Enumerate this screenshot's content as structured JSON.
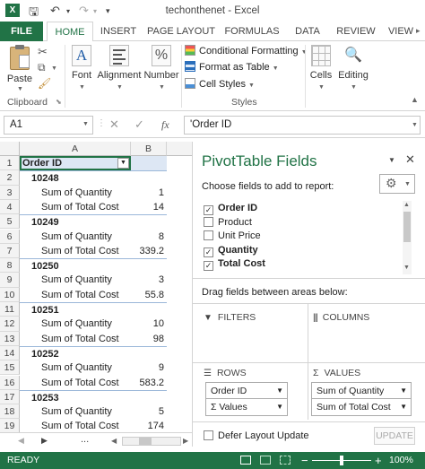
{
  "window": {
    "title": "techonthenet - Excel"
  },
  "ribbon": {
    "tabs": [
      "FILE",
      "HOME",
      "INSERT",
      "PAGE LAYOUT",
      "FORMULAS",
      "DATA",
      "REVIEW",
      "VIEW"
    ],
    "active_tab": "HOME",
    "paste_label": "Paste",
    "clipboard_label": "Clipboard",
    "font_label": "Font",
    "alignment_label": "Alignment",
    "number_label": "Number",
    "conditional_formatting": "Conditional Formatting",
    "format_as_table": "Format as Table",
    "cell_styles": "Cell Styles",
    "styles_label": "Styles",
    "cells_label": "Cells",
    "editing_label": "Editing"
  },
  "formula_bar": {
    "name_box": "A1",
    "fx": "fx",
    "formula": "'Order ID"
  },
  "grid": {
    "col_headers": [
      "A",
      "B"
    ],
    "rows": [
      {
        "n": "1",
        "a": "Order ID",
        "b": "",
        "type": "header"
      },
      {
        "n": "2",
        "a": "10248",
        "b": "",
        "type": "order"
      },
      {
        "n": "3",
        "a": "Sum of Quantity",
        "b": "1",
        "type": "val"
      },
      {
        "n": "4",
        "a": "Sum of Total Cost",
        "b": "14",
        "type": "val"
      },
      {
        "n": "5",
        "a": "10249",
        "b": "",
        "type": "order"
      },
      {
        "n": "6",
        "a": "Sum of Quantity",
        "b": "8",
        "type": "val"
      },
      {
        "n": "7",
        "a": "Sum of Total Cost",
        "b": "339.2",
        "type": "val"
      },
      {
        "n": "8",
        "a": "10250",
        "b": "",
        "type": "order"
      },
      {
        "n": "9",
        "a": "Sum of Quantity",
        "b": "3",
        "type": "val"
      },
      {
        "n": "10",
        "a": "Sum of Total Cost",
        "b": "55.8",
        "type": "val"
      },
      {
        "n": "11",
        "a": "10251",
        "b": "",
        "type": "order"
      },
      {
        "n": "12",
        "a": "Sum of Quantity",
        "b": "10",
        "type": "val"
      },
      {
        "n": "13",
        "a": "Sum of Total Cost",
        "b": "98",
        "type": "val"
      },
      {
        "n": "14",
        "a": "10252",
        "b": "",
        "type": "order"
      },
      {
        "n": "15",
        "a": "Sum of Quantity",
        "b": "9",
        "type": "val"
      },
      {
        "n": "16",
        "a": "Sum of Total Cost",
        "b": "583.2",
        "type": "val"
      },
      {
        "n": "17",
        "a": "10253",
        "b": "",
        "type": "order"
      },
      {
        "n": "18",
        "a": "Sum of Quantity",
        "b": "5",
        "type": "val"
      },
      {
        "n": "19",
        "a": "Sum of Total Cost",
        "b": "174",
        "type": "val"
      }
    ]
  },
  "pivot": {
    "title": "PivotTable Fields",
    "choose_label": "Choose fields to add to report:",
    "fields": [
      {
        "label": "Order ID",
        "checked": true,
        "bold": true
      },
      {
        "label": "Product",
        "checked": false,
        "bold": false
      },
      {
        "label": "Unit Price",
        "checked": false,
        "bold": false
      },
      {
        "label": "Quantity",
        "checked": true,
        "bold": true
      },
      {
        "label": "Total Cost",
        "checked": true,
        "bold": true
      }
    ],
    "drag_label": "Drag fields between areas below:",
    "filters_label": "FILTERS",
    "columns_label": "COLUMNS",
    "rows_label": "ROWS",
    "values_label": "VALUES",
    "rows_items": [
      "Order ID",
      "Σ Values"
    ],
    "values_items": [
      "Sum of Quantity",
      "Sum of Total Cost"
    ],
    "defer_label": "Defer Layout Update",
    "update_label": "UPDATE"
  },
  "status": {
    "ready": "READY",
    "zoom": "100%"
  },
  "colors": {
    "accent": "#217346"
  }
}
